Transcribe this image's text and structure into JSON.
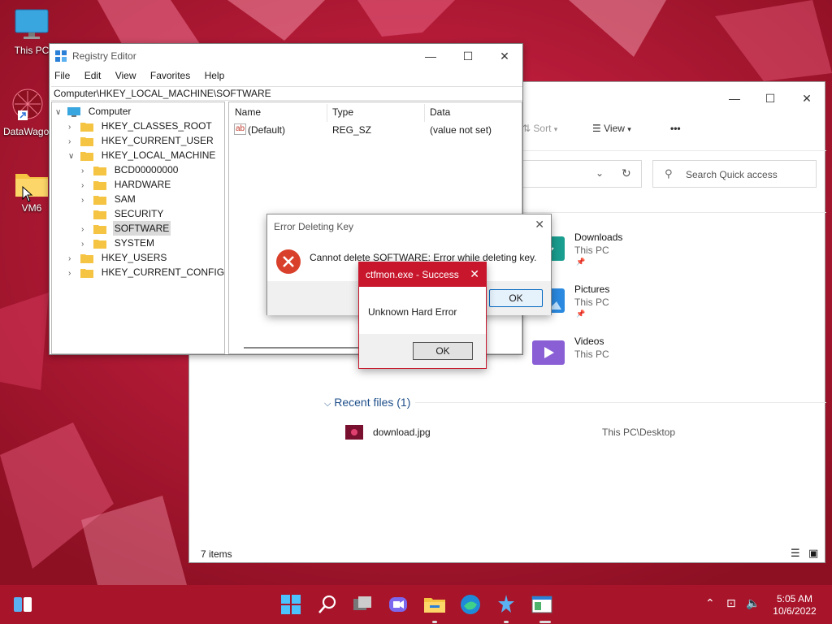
{
  "desktop": {
    "icons": [
      {
        "label": "This PC"
      },
      {
        "label": "DataWagon"
      },
      {
        "label": "VM6"
      }
    ]
  },
  "explorer": {
    "toolbar": {
      "sort_label": "Sort",
      "view_label": "View",
      "more_label": "•••"
    },
    "search_placeholder": "Search Quick access",
    "quick_access": [
      {
        "name": "Downloads",
        "location": "This PC",
        "icon": "downloads-folder-icon",
        "color": "#1a9e8f"
      },
      {
        "name": "Pictures",
        "location": "This PC",
        "icon": "pictures-folder-icon",
        "color": "#2b8ae0"
      },
      {
        "name": "Videos",
        "location": "This PC",
        "icon": "videos-folder-icon",
        "color": "#8a5fd6"
      }
    ],
    "recent_header": "Recent files (1)",
    "recent_files": [
      {
        "name": "download.jpg",
        "location": "This PC\\Desktop"
      }
    ],
    "status": "7 items"
  },
  "regedit": {
    "title": "Registry Editor",
    "menu": [
      "File",
      "Edit",
      "View",
      "Favorites",
      "Help"
    ],
    "address": "Computer\\HKEY_LOCAL_MACHINE\\SOFTWARE",
    "tree": [
      {
        "label": "Computer"
      },
      {
        "label": "HKEY_CLASSES_ROOT"
      },
      {
        "label": "HKEY_CURRENT_USER"
      },
      {
        "label": "HKEY_LOCAL_MACHINE"
      },
      {
        "label": "BCD00000000"
      },
      {
        "label": "HARDWARE"
      },
      {
        "label": "SAM"
      },
      {
        "label": "SECURITY"
      },
      {
        "label": "SOFTWARE"
      },
      {
        "label": "SYSTEM"
      },
      {
        "label": "HKEY_USERS"
      },
      {
        "label": "HKEY_CURRENT_CONFIG"
      }
    ],
    "columns": [
      "Name",
      "Type",
      "Data"
    ],
    "values": [
      {
        "name": "(Default)",
        "type": "REG_SZ",
        "data": "(value not set)"
      }
    ]
  },
  "error_dialog": {
    "title": "Error Deleting Key",
    "message": "Cannot delete SOFTWARE: Error while deleting key.",
    "ok_label": "OK"
  },
  "ctfmon_dialog": {
    "title": "ctfmon.exe - Success",
    "message": "Unknown Hard Error",
    "ok_label": "OK",
    "accent": "#c8172c"
  },
  "taskbar": {
    "time": "5:05 AM",
    "date": "10/6/2022",
    "accent": "#a8142a"
  }
}
